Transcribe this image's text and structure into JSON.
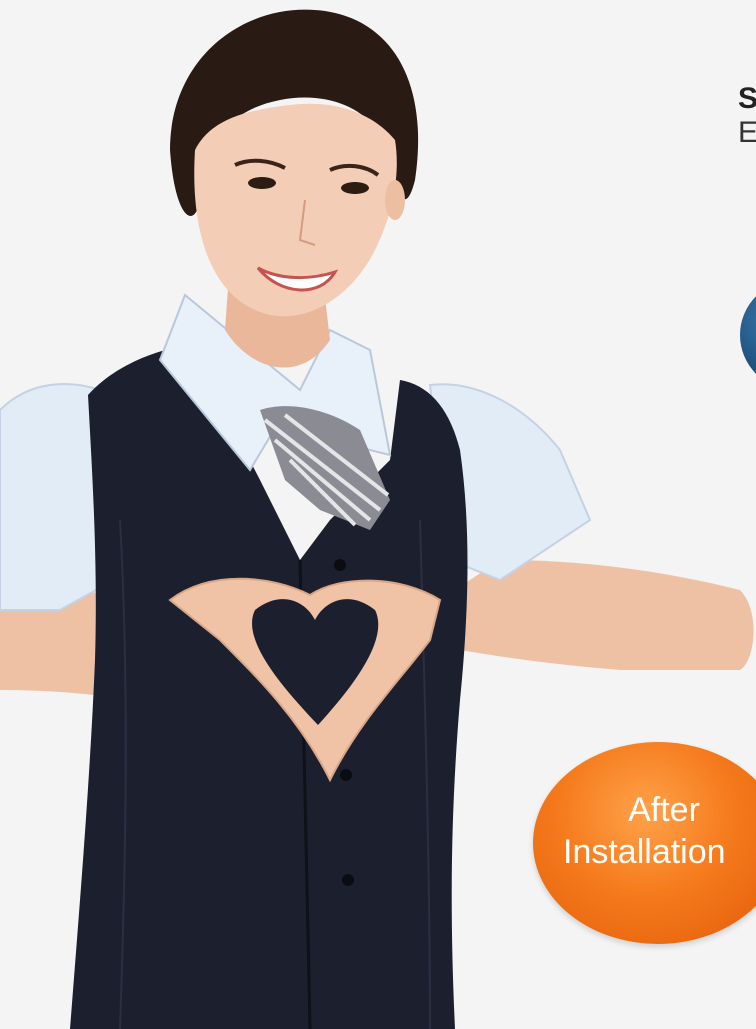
{
  "top_text": {
    "heading": "S",
    "sub": "E"
  },
  "badge": {
    "line1": "After",
    "line2": "Installation",
    "color": "#f57a1c"
  },
  "colors": {
    "background": "#f4f4f4",
    "vest": "#1c1f2e",
    "shirt": "#dfe9f5",
    "skin": "#f1c7ac",
    "hair": "#2a1a14",
    "blue_badge": "#1d4d78"
  },
  "icons": {
    "blue_badge": "blue-circle-icon"
  }
}
